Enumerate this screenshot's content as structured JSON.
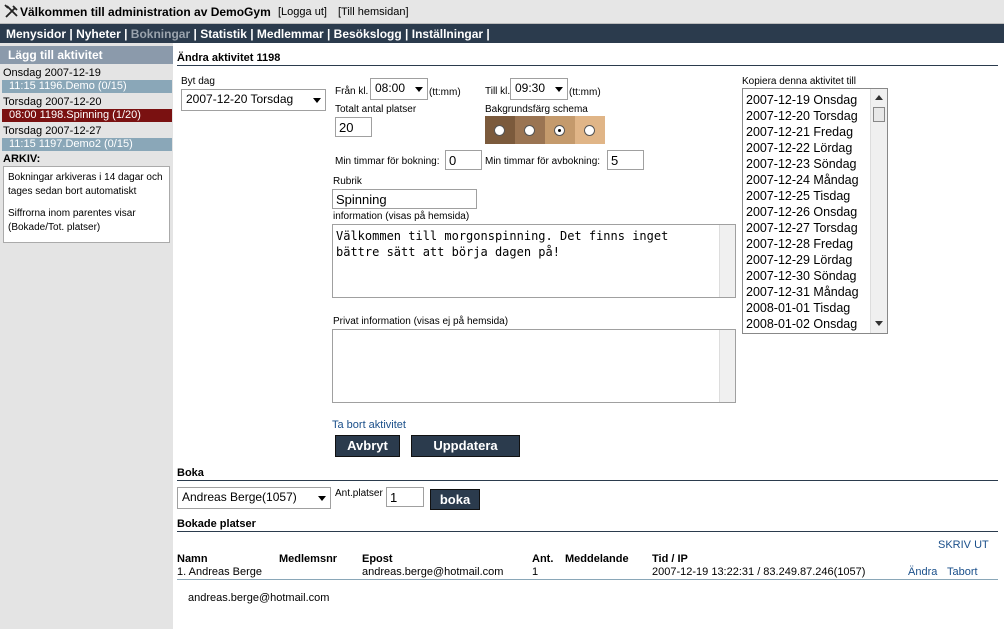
{
  "header": {
    "title": "Välkommen till administration av DemoGym",
    "logout_link": "[Logga ut]",
    "homepage_link": "[Till hemsidan]",
    "tools_icon": "wrench-screwdriver-icon"
  },
  "nav": {
    "items": [
      {
        "label": "Menysidor",
        "active": false
      },
      {
        "label": "Nyheter",
        "active": false
      },
      {
        "label": "Bokningar",
        "active": true
      },
      {
        "label": "Statistik",
        "active": false
      },
      {
        "label": "Medlemmar",
        "active": false
      },
      {
        "label": "Besökslogg",
        "active": false
      },
      {
        "label": "Inställningar",
        "active": false
      }
    ],
    "sep": "|"
  },
  "sidebar": {
    "add_label": "Lägg till aktivitet",
    "days": [
      {
        "date": "Onsdag 2007-12-19",
        "activity": "11:15 1196.Demo (0/15)",
        "selected": false
      },
      {
        "date": "Torsdag 2007-12-20",
        "activity": "08:00 1198.Spinning (1/20)",
        "selected": true
      },
      {
        "date": "Torsdag 2007-12-27",
        "activity": "11:15 1197.Demo2 (0/15)",
        "selected": false
      }
    ],
    "archive_label": "ARKIV:",
    "info_text_1": "Bokningar arkiveras i 14 dagar och tages sedan bort automatiskt",
    "info_text_2": "Siffrorna inom parentes visar (Bokade/Tot. platser)"
  },
  "edit": {
    "section_title": "Ändra aktivitet 1198",
    "change_day_label": "Byt dag",
    "change_day_value": "2007-12-20 Torsdag",
    "from_label": "Från kl.",
    "from_value": "08:00",
    "from_hint": "(tt:mm)",
    "to_label": "Till kl.",
    "to_value": "09:30",
    "to_hint": "(tt:mm)",
    "total_places_label": "Totalt antal platser",
    "total_places_value": "20",
    "bg_color_label": "Bakgrundsfärg schema",
    "bg_colors": [
      "#7b5a3c",
      "#9a7452",
      "#c49a6c",
      "#e0b587"
    ],
    "bg_selected_index": 2,
    "min_hours_booking_label": "Min timmar för bokning:",
    "min_hours_booking_value": "0",
    "min_hours_cancel_label": "Min timmar för avbokning:",
    "min_hours_cancel_value": "5",
    "heading_label": "Rubrik",
    "heading_value": "Spinning",
    "info_label": "information (visas på hemsida)",
    "info_value": "Välkommen till morgonspinning. Det finns inget bättre sätt att börja dagen på!",
    "private_label": "Privat information (visas ej på hemsida)",
    "private_value": "",
    "delete_link": "Ta bort aktivitet",
    "cancel_button": "Avbryt",
    "update_button": "Uppdatera",
    "copy_label": "Kopiera denna aktivitet till",
    "copy_options": [
      "2007-12-19 Onsdag",
      "2007-12-20 Torsdag",
      "2007-12-21 Fredag",
      "2007-12-22 Lördag",
      "2007-12-23 Söndag",
      "2007-12-24 Måndag",
      "2007-12-25 Tisdag",
      "2007-12-26 Onsdag",
      "2007-12-27 Torsdag",
      "2007-12-28 Fredag",
      "2007-12-29 Lördag",
      "2007-12-30 Söndag",
      "2007-12-31 Måndag",
      "2008-01-01 Tisdag",
      "2008-01-02 Onsdag"
    ]
  },
  "book": {
    "section_title": "Boka",
    "member_value": "Andreas Berge(1057)",
    "places_label": "Ant.platser",
    "places_value": "1",
    "book_button": "boka"
  },
  "booked": {
    "section_title": "Bokade platser",
    "print_link": "SKRIV UT",
    "headers": [
      "Namn",
      "Medlemsnr",
      "Epost",
      "Ant.",
      "Meddelande",
      "Tid / IP"
    ],
    "rows": [
      {
        "name": "1. Andreas Berge",
        "member_no": "",
        "email": "andreas.berge@hotmail.com",
        "count": "1",
        "message": "",
        "time_ip": "2007-12-19 13:22:31 / 83.249.87.246(1057)",
        "edit": "Ändra",
        "remove": "Tabort"
      }
    ],
    "email_list": "andreas.berge@hotmail.com"
  }
}
